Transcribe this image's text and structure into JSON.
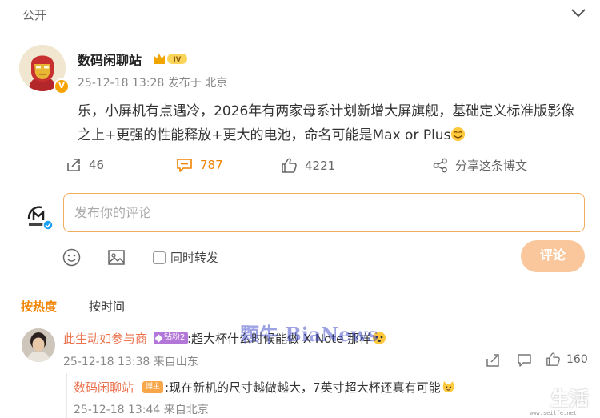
{
  "header": {
    "visibility": "公开"
  },
  "post": {
    "author": "数码闲聊站",
    "verified_badge": "V",
    "level_badge": "IV",
    "timestamp": "25-12-18 13:28",
    "location": "发布于 北京",
    "content": "乐，小屏机有点遇冷，2026年有两家母系计划新增大屏旗舰，基础定义标准版影像之上+更强的性能释放+更大的电池，命名可能是Max or Plus",
    "stats": {
      "reposts": "46",
      "comments": "787",
      "likes": "4221",
      "share_label": "分享这条博文"
    }
  },
  "comment_box": {
    "placeholder": "发布你的评论",
    "also_repost_label": "同时转发",
    "submit_label": "评论"
  },
  "sort": {
    "by_hot": "按热度",
    "by_time": "按时间"
  },
  "comments": [
    {
      "author": "此生动如参与商",
      "badge": "钻粉2",
      "text": ":超大杯什么时候能做 X Note 那样",
      "meta": "25-12-18 13:38 来自山东",
      "likes": "160",
      "replies": [
        {
          "author": "数码闲聊站",
          "badge": "博主",
          "text": ":现在新机的尺寸越做越大，7英寸超大杯还真有可能",
          "meta": "25-12-18 13:44 来自北京"
        }
      ]
    }
  ],
  "watermark": {
    "text": "颗牛 BiaNews",
    "logo": "生活",
    "url": "www.seilfe.net"
  },
  "colors": {
    "accent": "#f08300",
    "username": "#eb7350",
    "submit_bg": "#f9c79b",
    "input_border": "#f4ad5f"
  }
}
